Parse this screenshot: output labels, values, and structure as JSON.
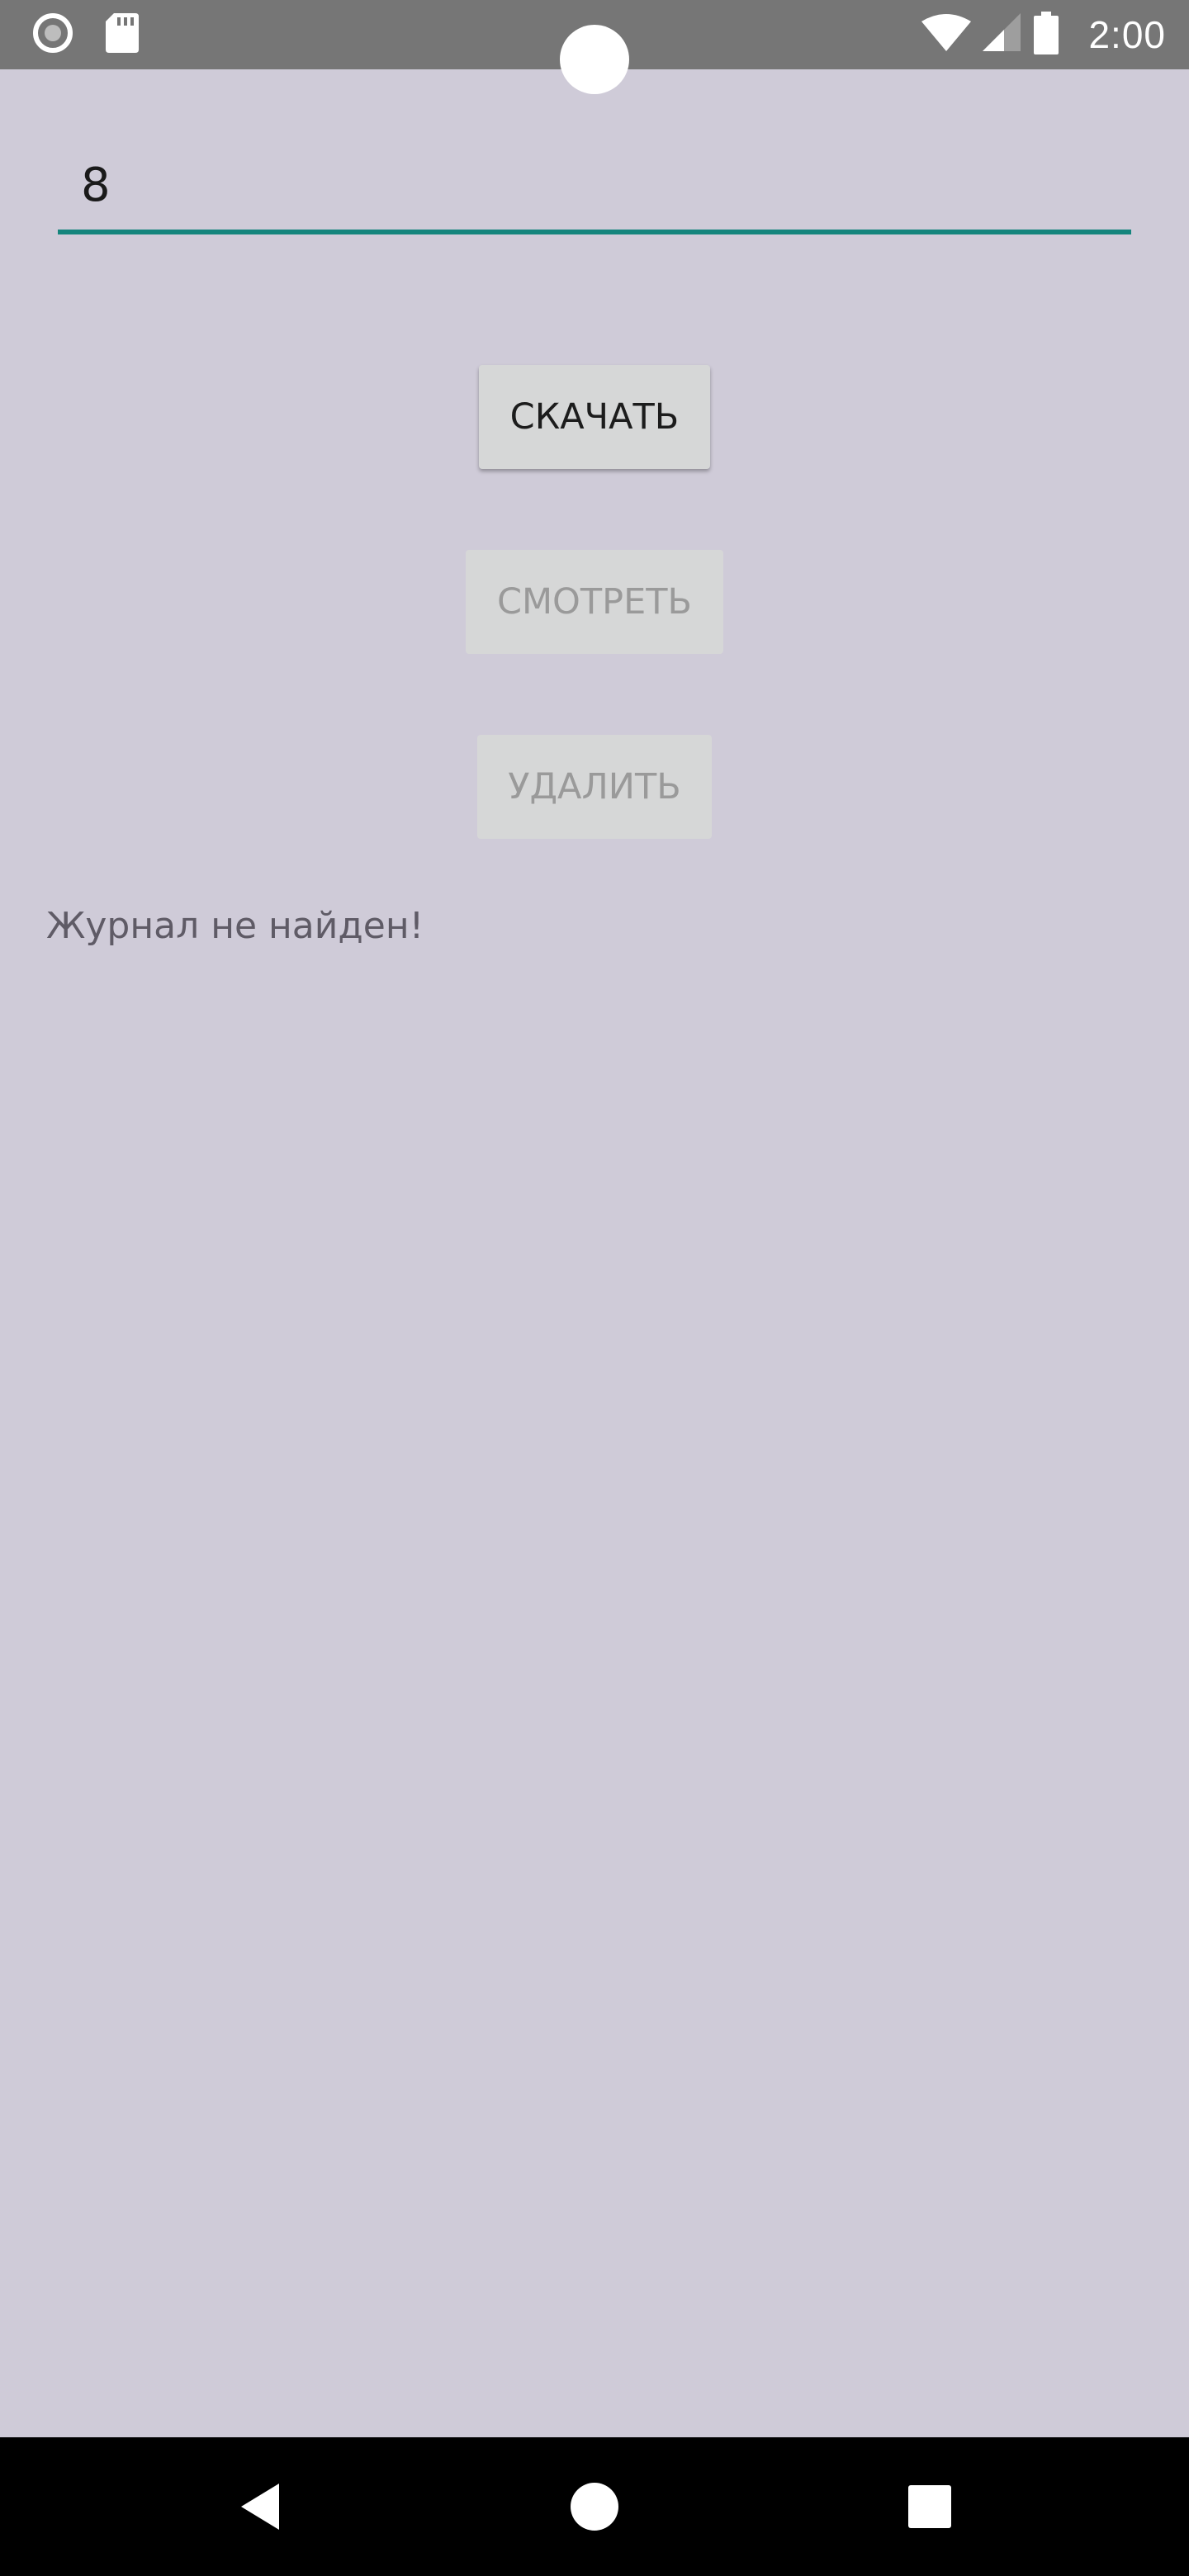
{
  "status_bar": {
    "time": "2:00",
    "icons": [
      "record-icon",
      "sd-card-icon",
      "wifi-icon",
      "signal-icon",
      "battery-icon"
    ]
  },
  "form": {
    "number_value": "8"
  },
  "buttons": {
    "download": {
      "label": "СКАЧАТЬ",
      "enabled": true
    },
    "view": {
      "label": "СМОТРЕТЬ",
      "enabled": false
    },
    "delete": {
      "label": "УДАЛИТЬ",
      "enabled": false
    }
  },
  "status": {
    "message": "Журнал не найден!"
  },
  "nav_bar": {
    "icons": [
      "back-icon",
      "home-icon",
      "recents-icon"
    ]
  },
  "colors": {
    "background": "#cfcbd8",
    "status_bar": "#767676",
    "accent_underline": "#15857d",
    "button": "#d6d7d7",
    "nav_bar": "#000000"
  }
}
